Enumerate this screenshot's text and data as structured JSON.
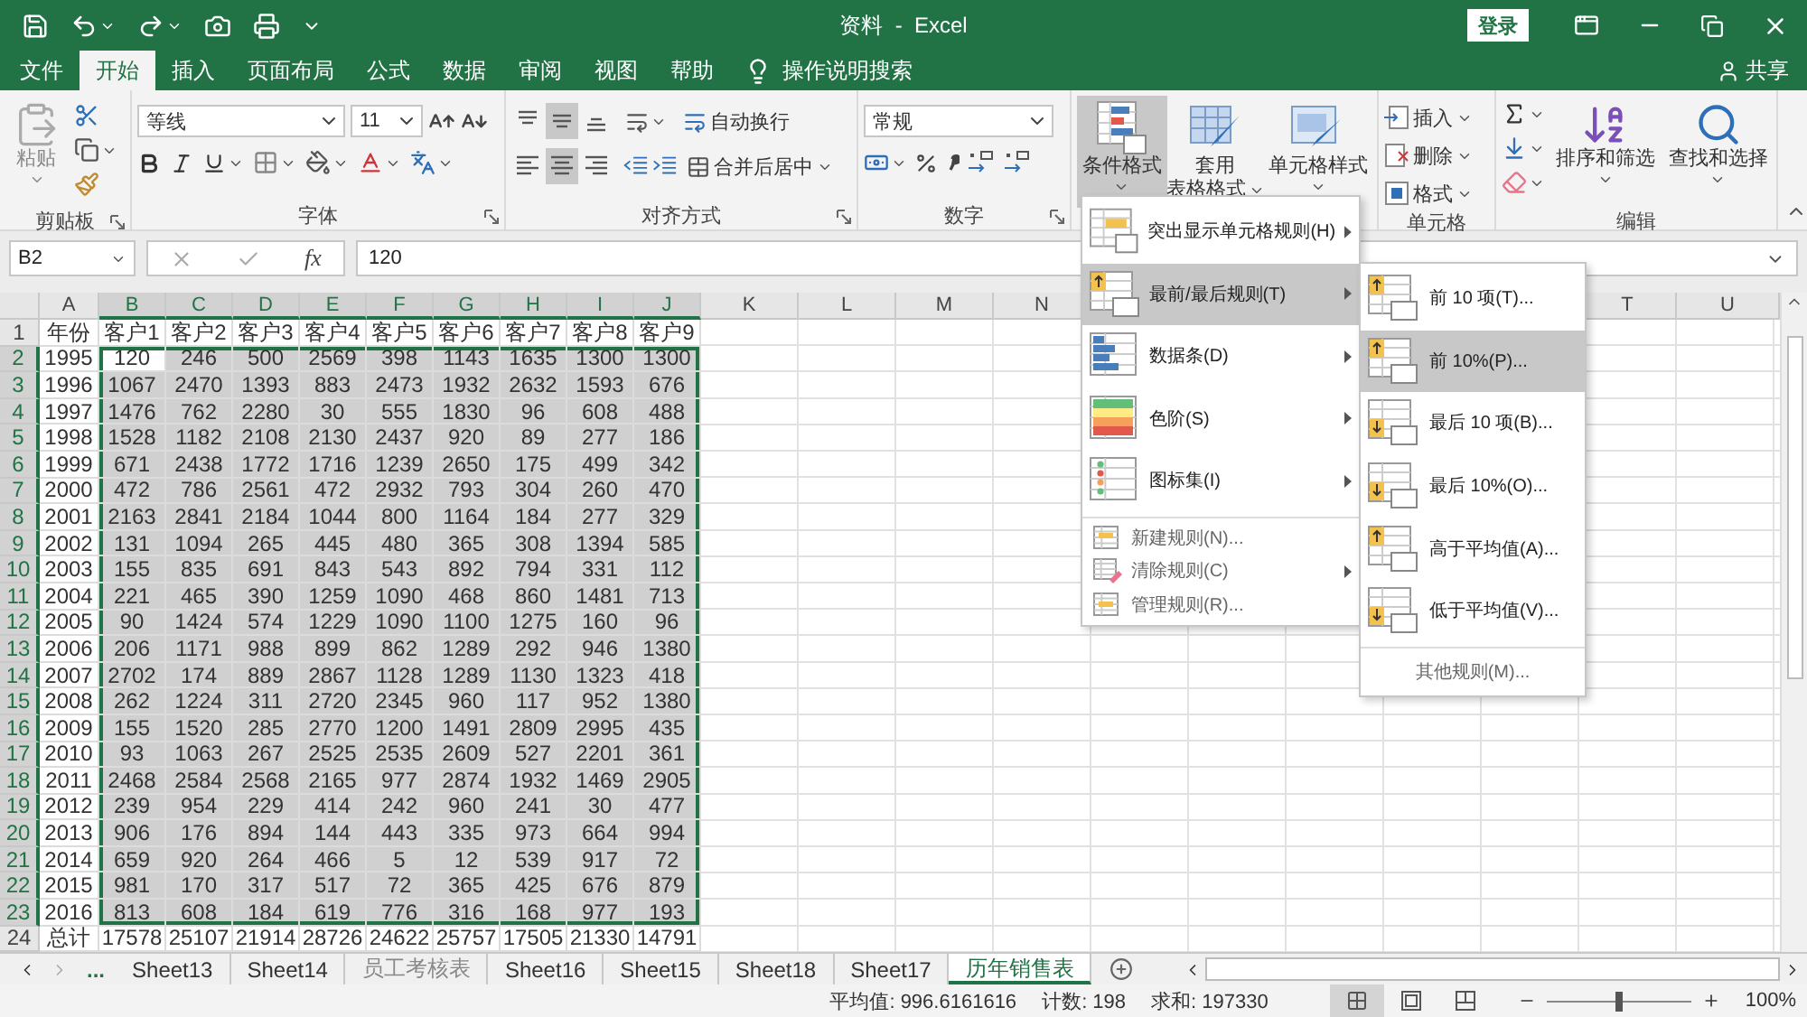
{
  "title_bar": {
    "title": "资料  -  Excel",
    "login": "登录"
  },
  "ribbon_tabs": [
    {
      "label": "文件",
      "selected": false
    },
    {
      "label": "开始",
      "selected": true
    },
    {
      "label": "插入",
      "selected": false
    },
    {
      "label": "页面布局",
      "selected": false
    },
    {
      "label": "公式",
      "selected": false
    },
    {
      "label": "数据",
      "selected": false
    },
    {
      "label": "审阅",
      "selected": false
    },
    {
      "label": "视图",
      "selected": false
    },
    {
      "label": "帮助",
      "selected": false
    }
  ],
  "tell_me": "操作说明搜索",
  "share": "共享",
  "clipboard": {
    "paste": "粘贴",
    "label": "剪贴板"
  },
  "font": {
    "name": "等线",
    "size": "11",
    "label": "字体"
  },
  "alignment": {
    "vertical_buttons": [
      {
        "kind": "top",
        "selected": false
      },
      {
        "kind": "middle",
        "selected": true
      },
      {
        "kind": "bottom",
        "selected": false
      }
    ],
    "horizontal_buttons": [
      {
        "kind": "left",
        "selected": false
      },
      {
        "kind": "center",
        "selected": true
      },
      {
        "kind": "right",
        "selected": false
      }
    ],
    "wrap_text": "自动换行",
    "merge": "合并后居中",
    "label": "对齐方式"
  },
  "number": {
    "format": "常规",
    "label": "数字"
  },
  "styles": {
    "buttons": [
      {
        "kind": "conditional",
        "lines": [
          "条件格式"
        ],
        "pressed": true
      },
      {
        "kind": "table",
        "lines": [
          "套用",
          "表格格式"
        ],
        "pressed": false
      },
      {
        "kind": "cell",
        "lines": [
          "单元格样式"
        ],
        "pressed": false
      }
    ]
  },
  "cells": {
    "items": [
      {
        "kind": "insert",
        "label": "插入"
      },
      {
        "kind": "delete",
        "label": "删除"
      },
      {
        "kind": "format",
        "label": "格式"
      }
    ],
    "label": "单元格"
  },
  "editing": {
    "sort": "排序和筛选",
    "find": "查找和选择",
    "label": "编辑"
  },
  "formula_bar": {
    "name_box": "B2",
    "fx": "fx",
    "value": "120"
  },
  "sheet": {
    "columns": [
      {
        "letter": "A",
        "selected": false
      },
      {
        "letter": "B",
        "selected": true
      },
      {
        "letter": "C",
        "selected": true
      },
      {
        "letter": "D",
        "selected": true
      },
      {
        "letter": "E",
        "selected": true
      },
      {
        "letter": "F",
        "selected": true
      },
      {
        "letter": "G",
        "selected": true
      },
      {
        "letter": "H",
        "selected": true
      },
      {
        "letter": "I",
        "selected": true
      },
      {
        "letter": "J",
        "selected": true
      },
      {
        "letter": "K",
        "selected": false
      },
      {
        "letter": "L",
        "selected": false
      },
      {
        "letter": "M",
        "selected": false
      },
      {
        "letter": "N",
        "selected": false
      }
    ],
    "columns_right": [
      {
        "letter": "T",
        "selected": false
      },
      {
        "letter": "U",
        "selected": false
      }
    ],
    "rows": [
      {
        "number": "1",
        "selected": false,
        "active": false,
        "cells": [
          "年份",
          "客户1",
          "客户2",
          "客户3",
          "客户4",
          "客户5",
          "客户6",
          "客户7",
          "客户8",
          "客户9"
        ]
      },
      {
        "number": "2",
        "selected": true,
        "active": true,
        "cells": [
          "1995",
          "120",
          "246",
          "500",
          "2569",
          "398",
          "1143",
          "1635",
          "1300",
          "1300"
        ]
      },
      {
        "number": "3",
        "selected": true,
        "active": false,
        "cells": [
          "1996",
          "1067",
          "2470",
          "1393",
          "883",
          "2473",
          "1932",
          "2632",
          "1593",
          "676"
        ]
      },
      {
        "number": "4",
        "selected": true,
        "active": false,
        "cells": [
          "1997",
          "1476",
          "762",
          "2280",
          "30",
          "555",
          "1830",
          "96",
          "608",
          "488"
        ]
      },
      {
        "number": "5",
        "selected": true,
        "active": false,
        "cells": [
          "1998",
          "1528",
          "1182",
          "2108",
          "2130",
          "2437",
          "920",
          "89",
          "277",
          "186"
        ]
      },
      {
        "number": "6",
        "selected": true,
        "active": false,
        "cells": [
          "1999",
          "671",
          "2438",
          "1772",
          "1716",
          "1239",
          "2650",
          "175",
          "499",
          "342"
        ]
      },
      {
        "number": "7",
        "selected": true,
        "active": false,
        "cells": [
          "2000",
          "472",
          "786",
          "2561",
          "472",
          "2932",
          "793",
          "304",
          "260",
          "470"
        ]
      },
      {
        "number": "8",
        "selected": true,
        "active": false,
        "cells": [
          "2001",
          "2163",
          "2841",
          "2184",
          "1044",
          "800",
          "1164",
          "184",
          "277",
          "329"
        ]
      },
      {
        "number": "9",
        "selected": true,
        "active": false,
        "cells": [
          "2002",
          "131",
          "1094",
          "265",
          "445",
          "480",
          "365",
          "308",
          "1394",
          "585"
        ]
      },
      {
        "number": "10",
        "selected": true,
        "active": false,
        "cells": [
          "2003",
          "155",
          "835",
          "691",
          "843",
          "543",
          "892",
          "794",
          "331",
          "112"
        ]
      },
      {
        "number": "11",
        "selected": true,
        "active": false,
        "cells": [
          "2004",
          "221",
          "465",
          "390",
          "1259",
          "1090",
          "468",
          "860",
          "1481",
          "713"
        ]
      },
      {
        "number": "12",
        "selected": true,
        "active": false,
        "cells": [
          "2005",
          "90",
          "1424",
          "574",
          "1229",
          "1090",
          "1100",
          "1275",
          "160",
          "96"
        ]
      },
      {
        "number": "13",
        "selected": true,
        "active": false,
        "cells": [
          "2006",
          "206",
          "1171",
          "988",
          "899",
          "862",
          "1289",
          "292",
          "946",
          "1380"
        ]
      },
      {
        "number": "14",
        "selected": true,
        "active": false,
        "cells": [
          "2007",
          "2702",
          "174",
          "889",
          "2867",
          "1128",
          "1289",
          "1130",
          "1323",
          "418"
        ]
      },
      {
        "number": "15",
        "selected": true,
        "active": false,
        "cells": [
          "2008",
          "262",
          "1224",
          "311",
          "2720",
          "2345",
          "960",
          "117",
          "952",
          "1380"
        ]
      },
      {
        "number": "16",
        "selected": true,
        "active": false,
        "cells": [
          "2009",
          "155",
          "1520",
          "285",
          "2770",
          "1200",
          "1491",
          "2809",
          "2995",
          "435"
        ]
      },
      {
        "number": "17",
        "selected": true,
        "active": false,
        "cells": [
          "2010",
          "93",
          "1063",
          "267",
          "2525",
          "2535",
          "2609",
          "527",
          "2201",
          "361"
        ]
      },
      {
        "number": "18",
        "selected": true,
        "active": false,
        "cells": [
          "2011",
          "2468",
          "2584",
          "2568",
          "2165",
          "977",
          "2874",
          "1932",
          "1469",
          "2905"
        ]
      },
      {
        "number": "19",
        "selected": true,
        "active": false,
        "cells": [
          "2012",
          "239",
          "954",
          "229",
          "414",
          "242",
          "960",
          "241",
          "30",
          "477"
        ]
      },
      {
        "number": "20",
        "selected": true,
        "active": false,
        "cells": [
          "2013",
          "906",
          "176",
          "894",
          "144",
          "443",
          "335",
          "973",
          "664",
          "994"
        ]
      },
      {
        "number": "21",
        "selected": true,
        "active": false,
        "cells": [
          "2014",
          "659",
          "920",
          "264",
          "466",
          "5",
          "12",
          "539",
          "917",
          "72"
        ]
      },
      {
        "number": "22",
        "selected": true,
        "active": false,
        "cells": [
          "2015",
          "981",
          "170",
          "317",
          "517",
          "72",
          "365",
          "425",
          "676",
          "879"
        ]
      },
      {
        "number": "23",
        "selected": true,
        "active": false,
        "cells": [
          "2016",
          "813",
          "608",
          "184",
          "619",
          "776",
          "316",
          "168",
          "977",
          "193"
        ]
      },
      {
        "number": "24",
        "selected": false,
        "active": false,
        "cells": [
          "总计",
          "17578",
          "25107",
          "21914",
          "28726",
          "24622",
          "25757",
          "17505",
          "21330",
          "14791"
        ]
      }
    ]
  },
  "conditional_menu": {
    "items": [
      {
        "kind": "highlight",
        "label": "突出显示单元格规则(H)",
        "submenu": true,
        "selected": false
      },
      {
        "kind": "topbottom",
        "label": "最前/最后规则(T)",
        "submenu": true,
        "selected": true
      },
      {
        "kind": "databar",
        "label": "数据条(D)",
        "submenu": true,
        "selected": false
      },
      {
        "kind": "colorscale",
        "label": "色阶(S)",
        "submenu": true,
        "selected": false
      },
      {
        "kind": "iconset",
        "label": "图标集(I)",
        "submenu": true,
        "selected": false
      },
      {
        "kind": "new",
        "label": "新建规则(N)...",
        "submenu": false,
        "selected": false
      },
      {
        "kind": "clear",
        "label": "清除规则(C)",
        "submenu": true,
        "selected": false
      },
      {
        "kind": "manage",
        "label": "管理规则(R)...",
        "submenu": false,
        "selected": false
      }
    ]
  },
  "submenu": {
    "items": [
      {
        "kind": "top",
        "label": "前 10 项(T)...",
        "selected": false
      },
      {
        "kind": "top",
        "label": "前 10%(P)...",
        "selected": true
      },
      {
        "kind": "bottom",
        "label": "最后 10 项(B)...",
        "selected": false
      },
      {
        "kind": "bottom",
        "label": "最后 10%(O)...",
        "selected": false
      },
      {
        "kind": "top",
        "label": "高于平均值(A)...",
        "selected": false
      },
      {
        "kind": "bottom",
        "label": "低于平均值(V)...",
        "selected": false
      }
    ],
    "more": "其他规则(M)..."
  },
  "sheet_tabs": {
    "more": "...",
    "tabs": [
      {
        "label": "Sheet13",
        "selected": false,
        "dimmed": false
      },
      {
        "label": "Sheet14",
        "selected": false,
        "dimmed": false
      },
      {
        "label": "员工考核表",
        "selected": false,
        "dimmed": true
      },
      {
        "label": "Sheet16",
        "selected": false,
        "dimmed": false
      },
      {
        "label": "Sheet15",
        "selected": false,
        "dimmed": false
      },
      {
        "label": "Sheet18",
        "selected": false,
        "dimmed": false
      },
      {
        "label": "Sheet17",
        "selected": false,
        "dimmed": false
      },
      {
        "label": "历年销售表",
        "selected": true,
        "dimmed": false
      }
    ]
  },
  "status_bar": {
    "average": "平均值: 996.6161616",
    "count": "计数: 198",
    "sum": "求和: 197330",
    "views": [
      {
        "kind": "normal",
        "selected": true
      },
      {
        "kind": "page_layout",
        "selected": false
      },
      {
        "kind": "page_break",
        "selected": false
      }
    ],
    "zoom": {
      "level": 0.5,
      "label": "100%"
    }
  }
}
